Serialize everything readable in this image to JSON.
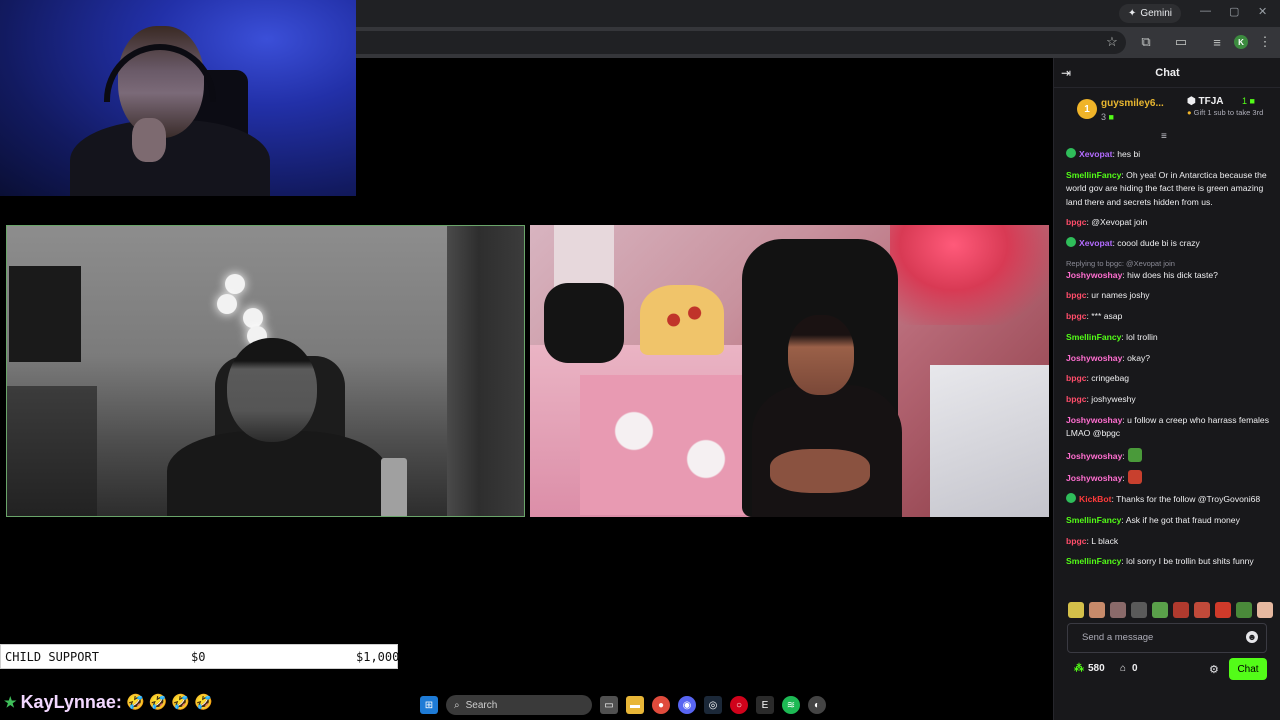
{
  "browser": {
    "gemini_label": "Gemini",
    "profile_initial": "K"
  },
  "overlay": {
    "donation_bar": {
      "label": "CHILD SUPPORT",
      "current": "$0",
      "goal": "$1,000"
    },
    "kay_line": {
      "user": "KayLynnae:",
      "emojis": [
        "🤣",
        "🤣",
        "🤣",
        "🤣"
      ]
    }
  },
  "taskbar": {
    "search_placeholder": "Search"
  },
  "chat": {
    "title": "Chat",
    "leaderboard": {
      "first": {
        "rank": "1",
        "name": "guysmiley6...",
        "count": "3"
      },
      "second": {
        "name": "TFJA",
        "count": "1",
        "gift_text": "Gift 1 sub to take 3rd"
      }
    },
    "messages": [
      {
        "user": "Xevopat",
        "color": "#b36bff",
        "badge": true,
        "text": ": hes bi"
      },
      {
        "user": "SmellinFancy",
        "color": "#53fc18",
        "badge": false,
        "text": ": Oh yea! Or in Antarctica because the world gov are hiding the fact there is green amazing land there and secrets hidden from us."
      },
      {
        "user": "bpgc",
        "color": "#ff4d6a",
        "badge": false,
        "text": ": @Xevopat join"
      },
      {
        "user": "Xevopat",
        "color": "#b36bff",
        "badge": true,
        "text": ": coool dude bi is crazy"
      },
      {
        "reply": "Replying to bpgc: @Xevopat join",
        "user": "Joshywoshay",
        "color": "#ff6ed0",
        "badge": false,
        "text": ": hiw does his dick taste?"
      },
      {
        "user": "bpgc",
        "color": "#ff4d6a",
        "badge": false,
        "text": ": ur names joshy"
      },
      {
        "user": "bpgc",
        "color": "#ff4d6a",
        "badge": false,
        "text": ": *** asap"
      },
      {
        "user": "SmellinFancy",
        "color": "#53fc18",
        "badge": false,
        "text": ": lol trollin"
      },
      {
        "user": "Joshywoshay",
        "color": "#ff6ed0",
        "badge": false,
        "text": ": okay?"
      },
      {
        "user": "bpgc",
        "color": "#ff4d6a",
        "badge": false,
        "text": ": cringebag"
      },
      {
        "user": "bpgc",
        "color": "#ff4d6a",
        "badge": false,
        "text": ": joshyweshy"
      },
      {
        "user": "Joshywoshay",
        "color": "#ff6ed0",
        "badge": false,
        "text": ": u follow a creep who harrass females LMAO @bpgc"
      },
      {
        "user": "Joshywoshay",
        "color": "#ff6ed0",
        "badge": false,
        "text": ":",
        "emote": "#4a9a3a"
      },
      {
        "user": "Joshywoshay",
        "color": "#ff6ed0",
        "badge": false,
        "text": ":",
        "emote": "#c8402e"
      },
      {
        "user": "KickBot",
        "color": "#ff3b3b",
        "badge": true,
        "text": ": Thanks for the follow @TroyGovoni68"
      },
      {
        "user": "SmellinFancy",
        "color": "#53fc18",
        "badge": false,
        "text": ": Ask if he got that fraud money"
      },
      {
        "user": "bpgc",
        "color": "#ff4d6a",
        "badge": false,
        "text": ": L black"
      },
      {
        "user": "SmellinFancy",
        "color": "#53fc18",
        "badge": false,
        "text": ": lol sorry I be trollin but shits funny"
      }
    ],
    "input_placeholder": "Send a message",
    "points": "580",
    "store_count": "0",
    "send_label": "Chat"
  }
}
